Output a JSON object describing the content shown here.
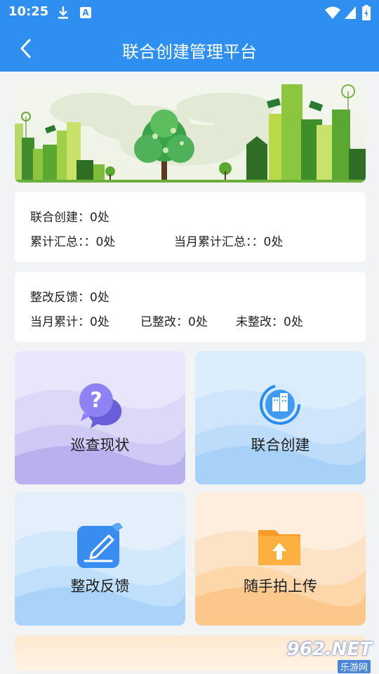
{
  "status_bar": {
    "time": "10:25",
    "a_badge": "A"
  },
  "header": {
    "title": "联合创建管理平台"
  },
  "card1": {
    "line1": "联合创建：0处",
    "line2_left": "累计汇总：：0处",
    "line2_right": "当月累计汇总：：0处"
  },
  "card2": {
    "line1": "整改反馈：0处",
    "month_total": "当月累计：0处",
    "fixed": "已整改：0处",
    "unfixed": "未整改：0处"
  },
  "tiles": [
    {
      "label": "巡查现状",
      "icon": "question-chat-icon",
      "color": "#8a7ef0"
    },
    {
      "label": "联合创建",
      "icon": "building-circle-icon",
      "color": "#3f9bf0"
    },
    {
      "label": "整改反馈",
      "icon": "edit-pen-icon",
      "color": "#3a8df0"
    },
    {
      "label": "随手拍上传",
      "icon": "upload-folder-icon",
      "color": "#f99a2a"
    }
  ],
  "watermark": {
    "main": "962.NET",
    "sub": "乐游网"
  },
  "colors": {
    "primary": "#2f8ff0",
    "page_bg": "#f2f3f5"
  }
}
